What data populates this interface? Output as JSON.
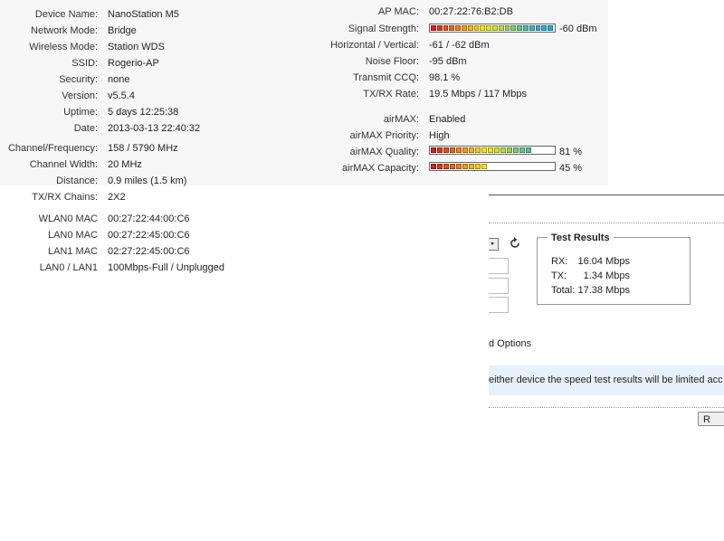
{
  "status_left": [
    {
      "label": "Device Name:",
      "value": "NanoStation M5"
    },
    {
      "label": "Network Mode:",
      "value": "Bridge"
    },
    {
      "label": "Wireless Mode:",
      "value": "Station WDS"
    },
    {
      "label": "SSID:",
      "value": "Rogerio-AP"
    },
    {
      "label": "Security:",
      "value": "none"
    },
    {
      "label": "Version:",
      "value": "v5.5.4"
    },
    {
      "label": "Uptime:",
      "value": "5 days 12:25:38"
    },
    {
      "label": "Date:",
      "value": "2013-03-13 22:40:32"
    },
    {
      "label": "Channel/Frequency:",
      "value": "158 / 5790 MHz"
    },
    {
      "label": "Channel Width:",
      "value": "20 MHz"
    },
    {
      "label": "Distance:",
      "value": "0.9 miles (1.5 km)"
    },
    {
      "label": "TX/RX Chains:",
      "value": "2X2"
    },
    {
      "label": "WLAN0 MAC",
      "value": "00:27:22:44:00:C6"
    },
    {
      "label": "LAN0 MAC",
      "value": "00:27:22:45:00:C6"
    },
    {
      "label": "LAN1 MAC",
      "value": "02:27:22:45:00:C6"
    },
    {
      "label": "LAN0 / LAN1",
      "value": "100Mbps-Full / Unplugged"
    }
  ],
  "status_right": {
    "ap_mac": {
      "label": "AP MAC:",
      "value": "00:27:22:76:B2:DB"
    },
    "signal": {
      "label": "Signal Strength:",
      "value": "-60 dBm",
      "level": 1.0
    },
    "hv": {
      "label": "Horizontal / Vertical:",
      "value": "-61 / -62 dBm"
    },
    "noise": {
      "label": "Noise Floor:",
      "value": "-95 dBm"
    },
    "ccq": {
      "label": "Transmit CCQ:",
      "value": "98.1 %"
    },
    "rate": {
      "label": "TX/RX Rate:",
      "value": "19.5 Mbps / 117 Mbps"
    },
    "airmax": {
      "label": "airMAX:",
      "value": "Enabled"
    },
    "priority": {
      "label": "airMAX Priority:",
      "value": "High"
    },
    "quality": {
      "label": "airMAX Quality:",
      "value": "81 %",
      "level": 0.81
    },
    "capacity": {
      "label": "airMAX Capacity:",
      "value": "45 %",
      "level": 0.45
    }
  },
  "meter_colors": [
    "#d91e1e",
    "#e3341c",
    "#ea4d1c",
    "#f0661c",
    "#f5801c",
    "#f79a1c",
    "#f9b41c",
    "#fbcd1c",
    "#fde41c",
    "#e9ea1c",
    "#cfe62a",
    "#b5e042",
    "#99d75c",
    "#7fce78",
    "#66c690",
    "#52bfa6",
    "#42b8bc",
    "#36b2cc",
    "#2dadda",
    "#28abe0"
  ],
  "speedtest": {
    "results_title": "Test Results",
    "rx_label": "RX:",
    "rx_value": "16.04 Mbps",
    "tx_label": "TX:",
    "tx_value": "1.34 Mbps",
    "total_label": "Total:",
    "total_value": "17.38 Mbps",
    "options_text": "d Options",
    "notice": "either device the speed test results will be limited acc",
    "run_label": "R"
  }
}
